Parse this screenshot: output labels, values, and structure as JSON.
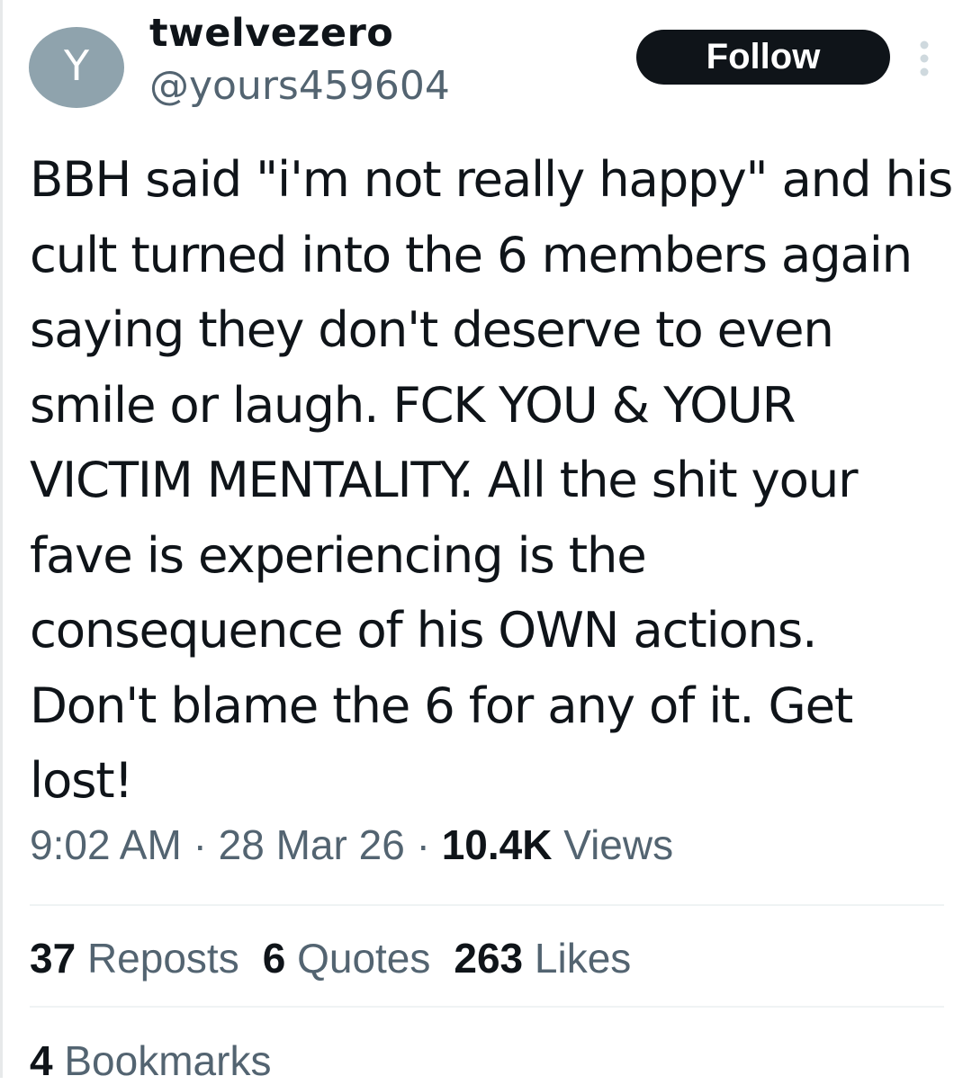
{
  "author": {
    "avatar_initial": "Y",
    "display_name": "twelvezero",
    "handle": "@yours459604"
  },
  "follow_label": "Follow",
  "more_icon": "vertical-dots-icon",
  "tweet_text": "BBH said \"i'm not really happy\" and his cult turned into the 6 members again saying they don't deserve to even smile or laugh. FCK YOU & YOUR VICTIM MENTALITY. All the shit your fave is experiencing is the consequence of his OWN actions. Don't blame the 6 for any of it. Get lost!",
  "meta": {
    "time": "9:02 AM",
    "separator": "·",
    "date": "28 Mar 26",
    "views_count": "10.4K",
    "views_label": "Views"
  },
  "stats": {
    "reposts_count": "37",
    "reposts_label": "Reposts",
    "quotes_count": "6",
    "quotes_label": "Quotes",
    "likes_count": "263",
    "likes_label": "Likes",
    "bookmarks_count": "4",
    "bookmarks_label": "Bookmarks"
  },
  "colors": {
    "text_primary": "#0f1419",
    "text_secondary": "#536471",
    "avatar_bg": "#8fa3ad",
    "button_bg": "#0f1419",
    "divider": "#eff3f4",
    "dots": "#cfd9de"
  }
}
